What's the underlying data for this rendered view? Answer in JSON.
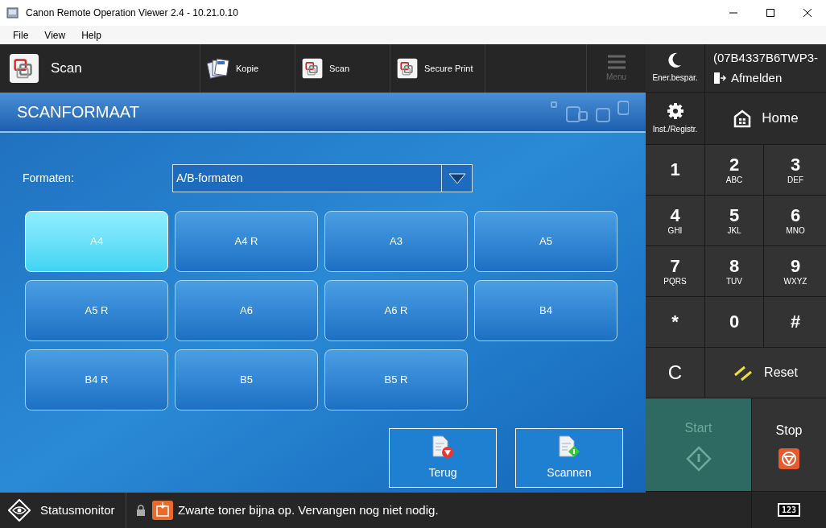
{
  "window": {
    "title": "Canon Remote Operation Viewer 2.4 - 10.21.0.10"
  },
  "menu": [
    "File",
    "View",
    "Help"
  ],
  "app_bar": {
    "current": {
      "label": "Scan"
    },
    "shortcuts": [
      {
        "label": "Kopie",
        "kind": "copy"
      },
      {
        "label": "Scan",
        "kind": "scan"
      },
      {
        "label": "Secure Print",
        "kind": "scan"
      }
    ],
    "menu_button": {
      "label": "Menu",
      "disabled": true
    }
  },
  "screen": {
    "title": "SCANFORMAAT",
    "format_label": "Formaten:",
    "format_value": "A/B-formaten",
    "sizes": [
      {
        "label": "A4",
        "selected": true
      },
      {
        "label": "A4 R",
        "selected": false
      },
      {
        "label": "A3",
        "selected": false
      },
      {
        "label": "A5",
        "selected": false
      },
      {
        "label": "A5 R",
        "selected": false
      },
      {
        "label": "A6",
        "selected": false
      },
      {
        "label": "A6 R",
        "selected": false
      },
      {
        "label": "B4",
        "selected": false
      },
      {
        "label": "B4 R",
        "selected": false
      },
      {
        "label": "B5",
        "selected": false
      },
      {
        "label": "B5 R",
        "selected": false
      }
    ],
    "buttons": [
      {
        "label": "Terug",
        "kind": "back"
      },
      {
        "label": "Scannen",
        "kind": "scan"
      }
    ]
  },
  "side": {
    "energy": {
      "label": "Ener.bespar."
    },
    "user": {
      "id": "(07B4337B6TWP3-",
      "logout": "Afmelden"
    },
    "settings": {
      "label": "Inst./Registr."
    },
    "home": {
      "label": "Home"
    },
    "keys": [
      {
        "digit": "1"
      },
      {
        "digit": "2",
        "letters": "ABC"
      },
      {
        "digit": "3",
        "letters": "DEF"
      },
      {
        "digit": "4",
        "letters": "GHI"
      },
      {
        "digit": "5",
        "letters": "JKL"
      },
      {
        "digit": "6",
        "letters": "MNO"
      },
      {
        "digit": "7",
        "letters": "PQRS"
      },
      {
        "digit": "8",
        "letters": "TUV"
      },
      {
        "digit": "9",
        "letters": "WXYZ"
      },
      {
        "digit": "*"
      },
      {
        "digit": "0"
      },
      {
        "digit": "#"
      }
    ],
    "clear": {
      "label": "C"
    },
    "reset": {
      "label": "Reset"
    },
    "start": {
      "label": "Start",
      "disabled": true
    },
    "stop": {
      "label": "Stop"
    },
    "keypad_toggle": {
      "label": "123"
    }
  },
  "status_bar": {
    "label": "Statusmonitor",
    "message": "Zwarte toner bijna op. Vervangen nog niet nodig."
  }
}
